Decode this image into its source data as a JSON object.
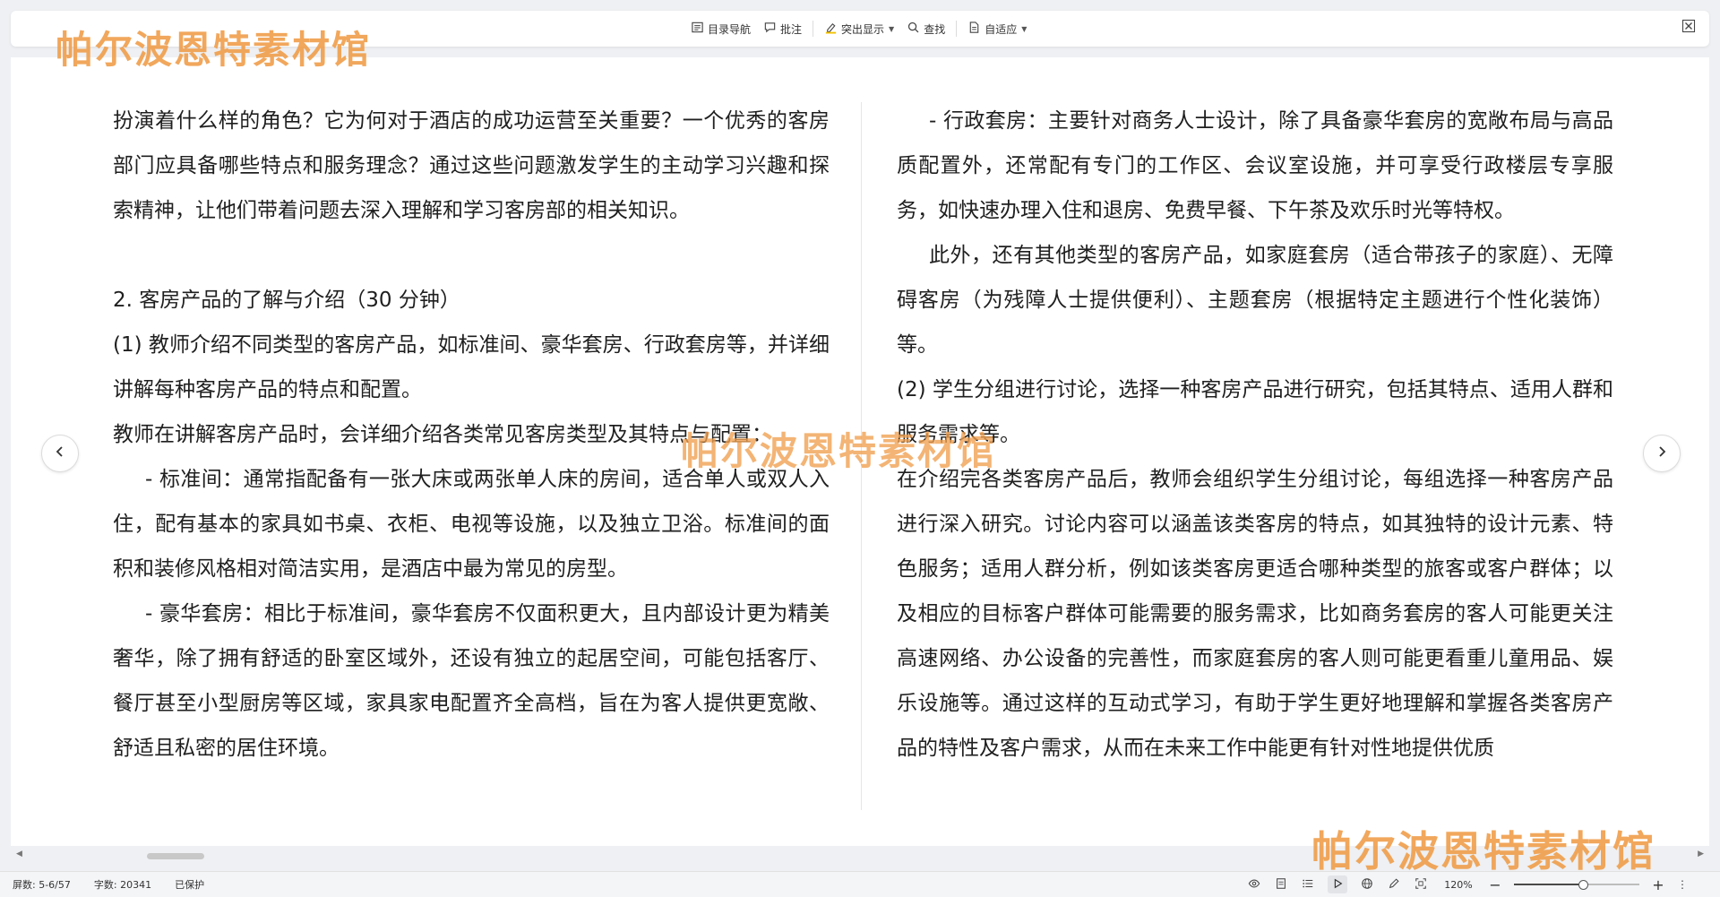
{
  "toolbar": {
    "toc_label": "目录导航",
    "comment_label": "批注",
    "highlight_label": "突出显示",
    "find_label": "查找",
    "fit_label": "自适应"
  },
  "document": {
    "left_column": [
      {
        "text": "扮演着什么样的角色？它为何对于酒店的成功运营至关重要？一个优秀的客房部门应具备哪些特点和服务理念？通过这些问题激发学生的主动学习兴趣和探索精神，让他们带着问题去深入理解和学习客房部的相关知识。",
        "indent": false
      },
      {
        "text": "",
        "indent": false
      },
      {
        "text": "2. 客房产品的了解与介绍（30 分钟）",
        "indent": false
      },
      {
        "text": "(1) 教师介绍不同类型的客房产品，如标准间、豪华套房、行政套房等，并详细讲解每种客房产品的特点和配置。",
        "indent": false
      },
      {
        "text": "教师在讲解客房产品时，会详细介绍各类常见客房类型及其特点与配置：",
        "indent": false
      },
      {
        "text": "- 标准间：通常指配备有一张大床或两张单人床的房间，适合单人或双人入住，配有基本的家具如书桌、衣柜、电视等设施，以及独立卫浴。标准间的面积和装修风格相对简洁实用，是酒店中最为常见的房型。",
        "indent": true
      },
      {
        "text": "- 豪华套房：相比于标准间，豪华套房不仅面积更大，且内部设计更为精美奢华，除了拥有舒适的卧室区域外，还设有独立的起居空间，可能包括客厅、餐厅甚至小型厨房等区域，家具家电配置齐全高档，旨在为客人提供更宽敞、舒适且私密的居住环境。",
        "indent": true
      }
    ],
    "right_column": [
      {
        "text": "- 行政套房：主要针对商务人士设计，除了具备豪华套房的宽敞布局与高品质配置外，还常配有专门的工作区、会议室设施，并可享受行政楼层专享服务，如快速办理入住和退房、免费早餐、下午茶及欢乐时光等特权。",
        "indent": true
      },
      {
        "text": "此外，还有其他类型的客房产品，如家庭套房（适合带孩子的家庭）、无障碍客房（为残障人士提供便利）、主题套房（根据特定主题进行个性化装饰）等。",
        "indent": true
      },
      {
        "text": "(2) 学生分组进行讨论，选择一种客房产品进行研究，包括其特点、适用人群和服务需求等。",
        "indent": false
      },
      {
        "text": "在介绍完各类客房产品后，教师会组织学生分组讨论，每组选择一种客房产品进行深入研究。讨论内容可以涵盖该类客房的特点，如其独特的设计元素、特色服务；适用人群分析，例如该类客房更适合哪种类型的旅客或客户群体；以及相应的目标客户群体可能需要的服务需求，比如商务套房的客人可能更关注高速网络、办公设备的完善性，而家庭套房的客人则可能更看重儿童用品、娱乐设施等。通过这样的互动式学习，有助于学生更好地理解和掌握各类客房产品的特性及客户需求，从而在未来工作中能更有针对性地提供优质",
        "indent": false
      }
    ]
  },
  "statusbar": {
    "page_info": "屏数: 5-6/57",
    "word_count": "字数: 20341",
    "protect_status": "已保护",
    "zoom": "120%",
    "zoom_fraction": 0.55
  },
  "watermark": {
    "text": "帕尔波恩特素材馆"
  },
  "colors": {
    "watermark": "#f0a04f",
    "background": "#eef0f3",
    "page": "#ffffff"
  }
}
